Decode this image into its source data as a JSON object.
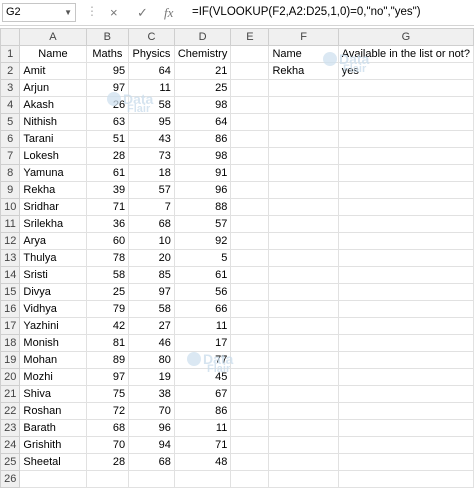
{
  "formula_bar": {
    "name_box": "G2",
    "cancel_icon": "×",
    "enter_icon": "✓",
    "fx_label": "fx",
    "formula": "=IF(VLOOKUP(F2,A2:D25,1,0)=0,\"no\",\"yes\")"
  },
  "columns": [
    "A",
    "B",
    "C",
    "D",
    "E",
    "F",
    "G"
  ],
  "header_row": {
    "row": "1",
    "A": "Name",
    "B": "Maths",
    "C": "Physics",
    "D": "Chemistry",
    "E": "",
    "F": "Name",
    "G": "Available in the list or not?"
  },
  "rows": [
    {
      "row": "2",
      "A": "Amit",
      "B": "95",
      "C": "64",
      "D": "21",
      "E": "",
      "F": "Rekha",
      "G": "yes"
    },
    {
      "row": "3",
      "A": "Arjun",
      "B": "97",
      "C": "11",
      "D": "25",
      "E": "",
      "F": "",
      "G": ""
    },
    {
      "row": "4",
      "A": "Akash",
      "B": "26",
      "C": "58",
      "D": "98",
      "E": "",
      "F": "",
      "G": ""
    },
    {
      "row": "5",
      "A": "Nithish",
      "B": "63",
      "C": "95",
      "D": "64",
      "E": "",
      "F": "",
      "G": ""
    },
    {
      "row": "6",
      "A": "Tarani",
      "B": "51",
      "C": "43",
      "D": "86",
      "E": "",
      "F": "",
      "G": ""
    },
    {
      "row": "7",
      "A": "Lokesh",
      "B": "28",
      "C": "73",
      "D": "98",
      "E": "",
      "F": "",
      "G": ""
    },
    {
      "row": "8",
      "A": "Yamuna",
      "B": "61",
      "C": "18",
      "D": "91",
      "E": "",
      "F": "",
      "G": ""
    },
    {
      "row": "9",
      "A": "Rekha",
      "B": "39",
      "C": "57",
      "D": "96",
      "E": "",
      "F": "",
      "G": ""
    },
    {
      "row": "10",
      "A": "Sridhar",
      "B": "71",
      "C": "7",
      "D": "88",
      "E": "",
      "F": "",
      "G": ""
    },
    {
      "row": "11",
      "A": "Srilekha",
      "B": "36",
      "C": "68",
      "D": "57",
      "E": "",
      "F": "",
      "G": ""
    },
    {
      "row": "12",
      "A": "Arya",
      "B": "60",
      "C": "10",
      "D": "92",
      "E": "",
      "F": "",
      "G": ""
    },
    {
      "row": "13",
      "A": "Thulya",
      "B": "78",
      "C": "20",
      "D": "5",
      "E": "",
      "F": "",
      "G": ""
    },
    {
      "row": "14",
      "A": "Sristi",
      "B": "58",
      "C": "85",
      "D": "61",
      "E": "",
      "F": "",
      "G": ""
    },
    {
      "row": "15",
      "A": "Divya",
      "B": "25",
      "C": "97",
      "D": "56",
      "E": "",
      "F": "",
      "G": ""
    },
    {
      "row": "16",
      "A": "Vidhya",
      "B": "79",
      "C": "58",
      "D": "66",
      "E": "",
      "F": "",
      "G": ""
    },
    {
      "row": "17",
      "A": "Yazhini",
      "B": "42",
      "C": "27",
      "D": "11",
      "E": "",
      "F": "",
      "G": ""
    },
    {
      "row": "18",
      "A": "Monish",
      "B": "81",
      "C": "46",
      "D": "17",
      "E": "",
      "F": "",
      "G": ""
    },
    {
      "row": "19",
      "A": "Mohan",
      "B": "89",
      "C": "80",
      "D": "77",
      "E": "",
      "F": "",
      "G": ""
    },
    {
      "row": "20",
      "A": "Mozhi",
      "B": "97",
      "C": "19",
      "D": "45",
      "E": "",
      "F": "",
      "G": ""
    },
    {
      "row": "21",
      "A": "Shiva",
      "B": "75",
      "C": "38",
      "D": "67",
      "E": "",
      "F": "",
      "G": ""
    },
    {
      "row": "22",
      "A": "Roshan",
      "B": "72",
      "C": "70",
      "D": "86",
      "E": "",
      "F": "",
      "G": ""
    },
    {
      "row": "23",
      "A": "Barath",
      "B": "68",
      "C": "96",
      "D": "11",
      "E": "",
      "F": "",
      "G": ""
    },
    {
      "row": "24",
      "A": "Grishith",
      "B": "70",
      "C": "94",
      "D": "71",
      "E": "",
      "F": "",
      "G": ""
    },
    {
      "row": "25",
      "A": "Sheetal",
      "B": "28",
      "C": "68",
      "D": "48",
      "E": "",
      "F": "",
      "G": ""
    },
    {
      "row": "26",
      "A": "",
      "B": "",
      "C": "",
      "D": "",
      "E": "",
      "F": "",
      "G": ""
    }
  ],
  "watermark": {
    "line1": "Data",
    "line2": "Flair"
  },
  "colors": {
    "header_bg": "#f0f0f0",
    "gridline": "#e1e1e1",
    "watermark": "#c9dceb"
  }
}
